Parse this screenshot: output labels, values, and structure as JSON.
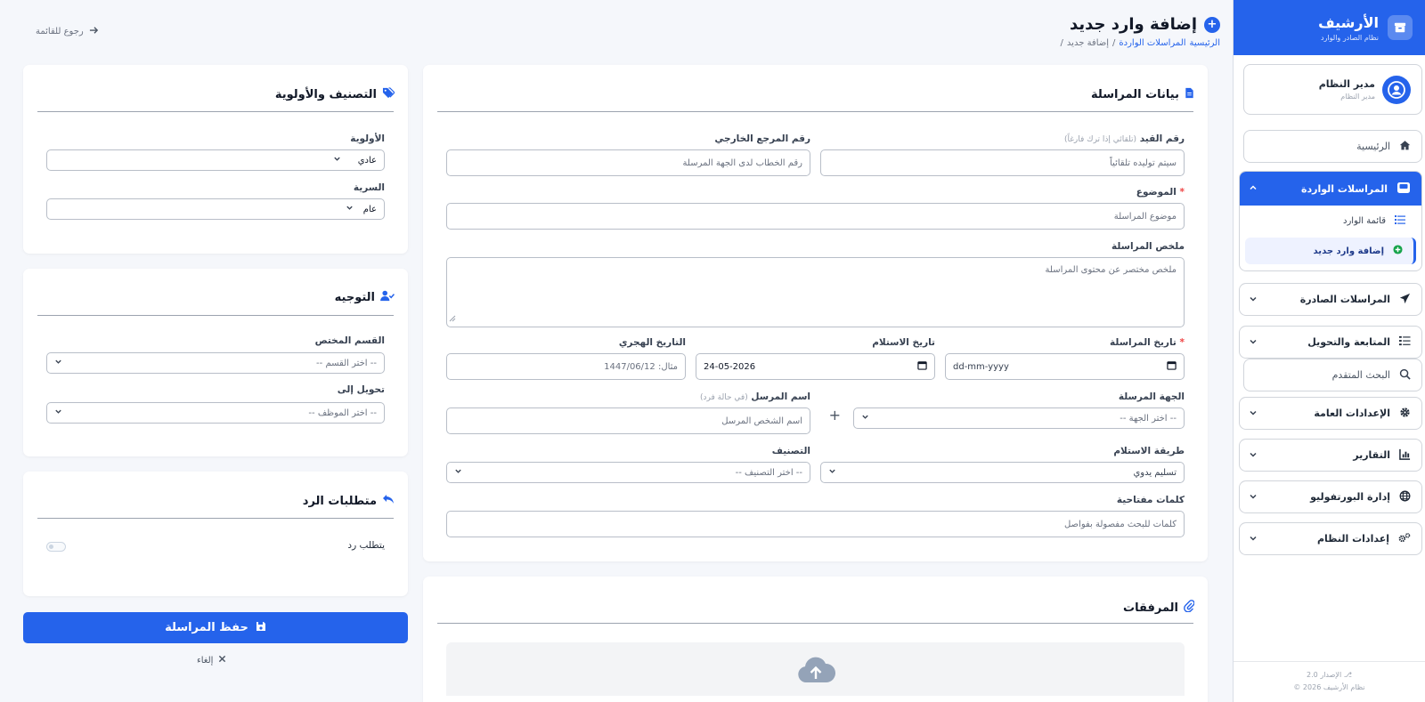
{
  "app": {
    "title": "الأرشيف",
    "subtitle": "نظام الصادر والوارد",
    "version": "الإصدار 2.0",
    "copyright": "© 2026 نظام الأرشيف"
  },
  "user": {
    "name": "مدير النظام",
    "role": "مدير النظام"
  },
  "nav": {
    "home": "الرئيسية",
    "incoming": "المراسلات الواردة",
    "incoming_list": "قائمة الوارد",
    "incoming_add": "إضافة وارد جديد",
    "outgoing": "المراسلات الصادرة",
    "followup": "المتابعة والتحويل",
    "search": "البحث المتقدم",
    "settings": "الإعدادات العامة",
    "reports": "التقارير",
    "portfolio": "إدارة البورتفوليو",
    "system": "إعدادات النظام"
  },
  "page": {
    "title": "إضافة وارد جديد",
    "back": "رجوع للقائمة",
    "breadcrumb": [
      "الرئيسية",
      "المراسلات الواردة",
      "/",
      "إضافة جديد",
      "/"
    ]
  },
  "form": {
    "card_title": "بيانات المراسلة",
    "reg_label": "رقم القيد",
    "reg_hint": "(تلقائي إذا ترك فارغاً)",
    "reg_placeholder": "سيتم توليده تلقائياً",
    "ext_label": "رقم المرجع الخارجي",
    "ext_placeholder": "رقم الخطاب لدى الجهة المرسلة",
    "subject_label": "الموضوع",
    "required_mark": "*",
    "subject_placeholder": "موضوع المراسلة",
    "summary_label": "ملخص المراسلة",
    "summary_placeholder": "ملخص مختصر عن محتوى المراسلة",
    "doc_date_label": "تاريخ المراسلة",
    "doc_date_value": "dd-mm-yyyy",
    "recv_date_label": "تاريخ الاستلام",
    "recv_date_value": "24-05-2026",
    "hijri_label": "التاريخ الهجري",
    "hijri_placeholder": "مثال: 1447/06/12",
    "sender_org_label": "الجهة المرسلة",
    "sender_org_value": "-- اختر الجهة --",
    "add_sign": "+",
    "sender_name_label": "اسم المرسل",
    "sender_name_hint": "(في حالة فرد)",
    "sender_name_placeholder": "اسم الشخص المرسل",
    "method_label": "طريقة الاستلام",
    "method_value": "تسليم يدوي",
    "class_label": "التصنيف",
    "class_value": "-- اختر التصنيف --",
    "keywords_label": "كلمات مفتاحية",
    "keywords_placeholder": "كلمات للبحث مفصولة بفواصل"
  },
  "attachments": {
    "title": "المرفقات"
  },
  "classification": {
    "title": "التصنيف والأولوية",
    "priority_label": "الأولوية",
    "priority_value": "عادي",
    "secrecy_label": "السرية",
    "secrecy_value": "عام"
  },
  "routing": {
    "title": "التوجيه",
    "dept_label": "القسم المختص",
    "dept_value": "-- اختر القسم --",
    "forward_label": "تحويل إلى",
    "forward_value": "-- اختر الموظف --"
  },
  "reply": {
    "title": "متطلبات الرد",
    "needs_reply_label": "يتطلب رد",
    "needs_reply": false
  },
  "actions": {
    "save": "حفظ المراسلة",
    "cancel": "إلغاء"
  },
  "colors": {
    "primary": "#2563eb",
    "background": "#f5f7fb",
    "danger": "#ef4444"
  }
}
